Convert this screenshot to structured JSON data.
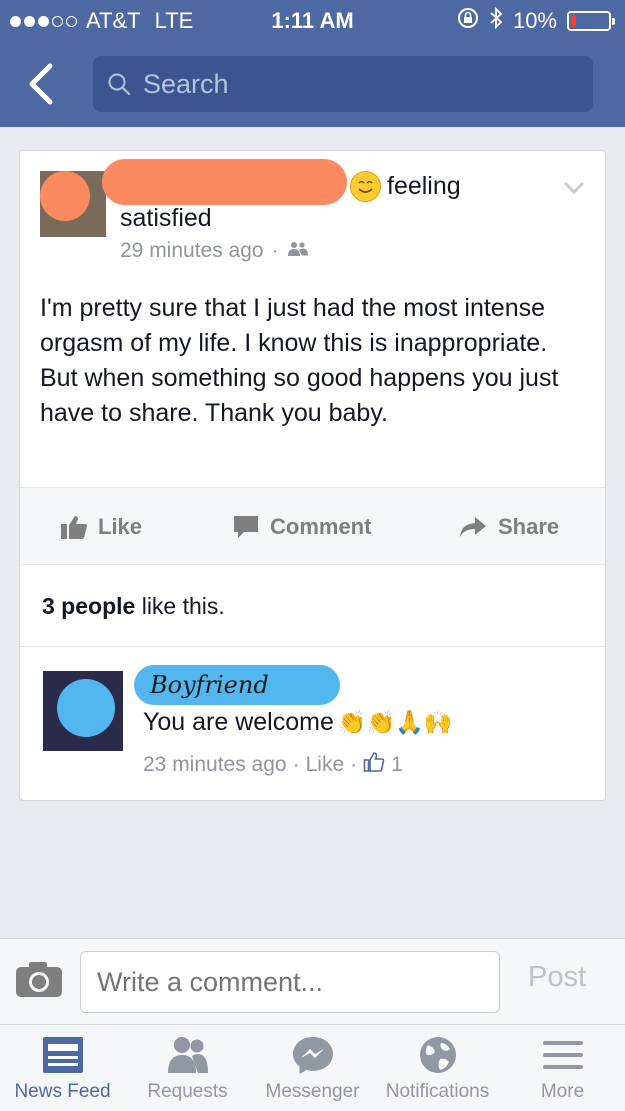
{
  "status_bar": {
    "carrier": "AT&T",
    "network": "LTE",
    "time": "1:11 AM",
    "battery": "10%"
  },
  "nav": {
    "search_placeholder": "Search"
  },
  "post": {
    "feeling_label": "feeling",
    "feeling_value": "satisfied",
    "time_ago": "29 minutes ago",
    "body": "I'm pretty sure that I just had the most intense orgasm of my life. I know this is inappropriate. But when something so good happens you just have to share. Thank you baby.",
    "actions": {
      "like": "Like",
      "comment": "Comment",
      "share": "Share"
    },
    "likes_count": "3 people",
    "likes_suffix": " like this."
  },
  "comment": {
    "author": "Boyfriend",
    "text": "You are welcome",
    "emoji": "👏👏🙏🙌",
    "time_ago": "23 minutes ago",
    "like_label": "Like",
    "like_count": "1"
  },
  "composer": {
    "placeholder": "Write a comment...",
    "post_label": "Post"
  },
  "tabs": [
    {
      "label": "News Feed",
      "icon": "news-feed-icon",
      "active": true
    },
    {
      "label": "Requests",
      "icon": "requests-icon",
      "active": false
    },
    {
      "label": "Messenger",
      "icon": "messenger-icon",
      "active": false
    },
    {
      "label": "Notifications",
      "icon": "globe-icon",
      "active": false
    },
    {
      "label": "More",
      "icon": "menu-icon",
      "active": false
    }
  ],
  "colors": {
    "brand": "#4e69a2",
    "redaction_name": "#fb8a61",
    "redaction_comment": "#52b7ef"
  }
}
